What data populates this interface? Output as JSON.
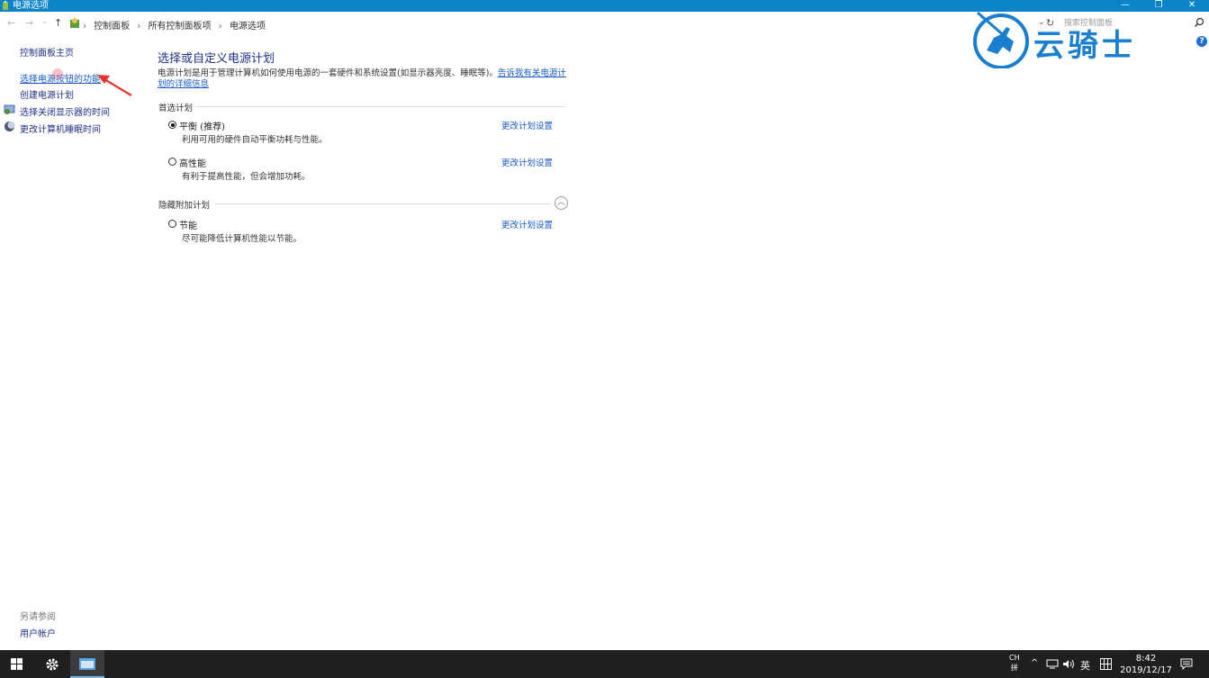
{
  "window": {
    "title": "电源选项",
    "minimize": "—",
    "restore": "❐",
    "close": "✕"
  },
  "address": {
    "back": "←",
    "forward": "→",
    "history": "⌄",
    "up": "↑",
    "breadcrumb": [
      "控制面板",
      "所有控制面板项",
      "电源选项"
    ],
    "separator": "›",
    "refresh": "↻",
    "dropdown": "⌄",
    "search_placeholder": "搜索控制面板"
  },
  "help": "?",
  "watermark": {
    "text": "云骑士"
  },
  "sidebar": {
    "items": [
      {
        "label": "控制面板主页"
      },
      {
        "label": "选择电源按钮的功能"
      },
      {
        "label": "创建电源计划"
      },
      {
        "label": "选择关闭显示器的时间",
        "icon": "display-power-icon"
      },
      {
        "label": "更改计算机睡眠时间",
        "icon": "moon-sleep-icon"
      }
    ],
    "see_also": "另请参阅",
    "see_also_items": [
      {
        "label": "用户帐户"
      }
    ]
  },
  "main": {
    "title": "选择或自定义电源计划",
    "description": "电源计划是用于管理计算机如何使用电源的一套硬件和系统设置(如显示器亮度、睡眠等)。",
    "description_link": "告诉我有关电源计划的详细信息",
    "preferred_section": "首选计划",
    "hidden_section": "隐藏附加计划",
    "collapse": "︿",
    "plans": [
      {
        "name": "平衡 (推荐)",
        "desc": "利用可用的硬件自动平衡功耗与性能。",
        "link": "更改计划设置",
        "selected": true
      },
      {
        "name": "高性能",
        "desc": "有利于提高性能，但会增加功耗。",
        "link": "更改计划设置",
        "selected": false
      },
      {
        "name": "节能",
        "desc": "尽可能降低计算机性能以节能。",
        "link": "更改计划设置",
        "selected": false
      }
    ]
  },
  "taskbar": {
    "ime_top": "CH",
    "ime_bottom": "拼",
    "tray_up": "^",
    "ime_lang": "英",
    "time": "8:42",
    "date": "2019/12/17"
  },
  "colors": {
    "titlebar": "#0a83c9",
    "link": "#1a5bc4",
    "heading": "#1e3287",
    "taskbar": "#1f1f1f"
  }
}
